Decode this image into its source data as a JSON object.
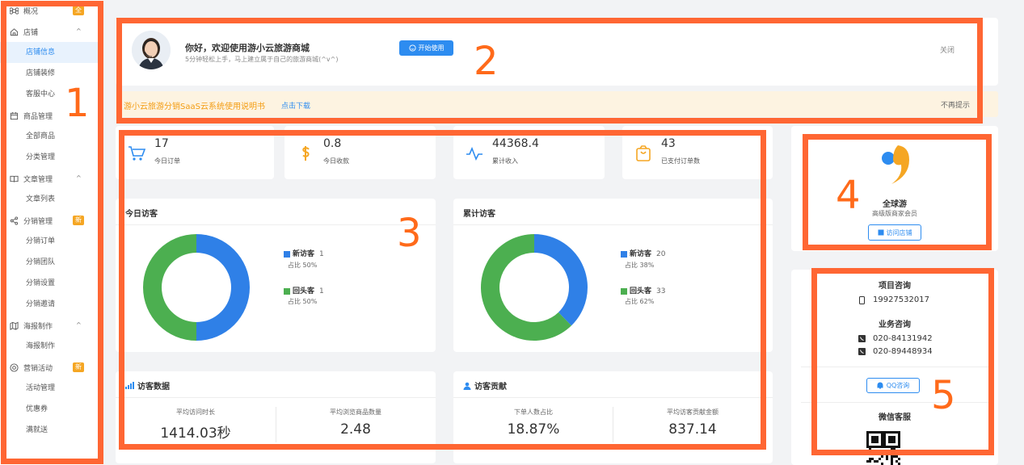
{
  "sidebar": {
    "groups": [
      {
        "label": "概况",
        "icon": "command-icon",
        "badge": "全"
      },
      {
        "label": "店铺",
        "icon": "home-icon",
        "chevron": "^",
        "items": [
          "店铺信息",
          "店铺装修",
          "客服中心"
        ]
      },
      {
        "label": "商品管理",
        "icon": "calendar-icon",
        "chevron": "^",
        "items": [
          "全部商品",
          "分类管理"
        ]
      },
      {
        "label": "文章管理",
        "icon": "book-icon",
        "chevron": "^",
        "items": [
          "文章列表"
        ]
      },
      {
        "label": "分销管理",
        "icon": "share-icon",
        "badge": "新",
        "items": [
          "分销订单",
          "分销团队",
          "分销设置",
          "分销邀请"
        ]
      },
      {
        "label": "海报制作",
        "icon": "map-icon",
        "chevron": "^",
        "items": [
          "海报制作"
        ]
      },
      {
        "label": "营销活动",
        "icon": "aperture-icon",
        "badge": "新",
        "items": [
          "活动管理",
          "优惠券",
          "满就送"
        ]
      }
    ],
    "active_item": "店铺信息"
  },
  "welcome": {
    "title": "你好，欢迎使用游小云旅游商城",
    "subtitle": "5分钟轻松上手，马上建立属于自己的旅游商城(^v^)",
    "start_button": "开始使用",
    "close": "关闭"
  },
  "notice": {
    "text": "游小云旅游分销SaaS云系统使用说明书",
    "link": "点击下载",
    "dismiss": "不再提示"
  },
  "stats": [
    {
      "value": "17",
      "label": "今日订单",
      "icon": "cart-icon"
    },
    {
      "value": "0.8",
      "label": "今日收款",
      "icon": "dollar-icon"
    },
    {
      "value": "44368.4",
      "label": "累计收入",
      "icon": "activity-icon"
    },
    {
      "value": "43",
      "label": "已支付订单数",
      "icon": "bag-icon"
    }
  ],
  "today_visitors": {
    "title": "今日访客",
    "new_label": "新访客",
    "new_count": "1",
    "new_pct": "占比  50%",
    "return_label": "回头客",
    "return_count": "1",
    "return_pct": "占比  50%"
  },
  "total_visitors": {
    "title": "累计访客",
    "new_label": "新访客",
    "new_count": "20",
    "new_pct": "占比  38%",
    "return_label": "回头客",
    "return_count": "33",
    "return_pct": "占比  62%"
  },
  "chart_data": [
    {
      "type": "pie",
      "title": "今日访客",
      "labels": [
        "新访客",
        "回头客"
      ],
      "values": [
        1,
        1
      ],
      "percent": [
        50,
        50
      ],
      "colors": [
        "#2f80e7",
        "#4caf50"
      ]
    },
    {
      "type": "pie",
      "title": "累计访客",
      "labels": [
        "新访客",
        "回头客"
      ],
      "values": [
        20,
        33
      ],
      "percent": [
        38,
        62
      ],
      "colors": [
        "#2f80e7",
        "#4caf50"
      ]
    }
  ],
  "visitor_data": {
    "title": "访客数据",
    "m1_label": "平均访问时长",
    "m1_value": "1414.03秒",
    "m2_label": "平均浏览商品数量",
    "m2_value": "2.48"
  },
  "visitor_contribution": {
    "title": "访客贡献",
    "m1_label": "下单人数占比",
    "m1_value": "18.87%",
    "m2_label": "平均访客贡献金额",
    "m2_value": "837.14"
  },
  "brand": {
    "name": "全球游",
    "level": "高级版商家会员",
    "visit_button": "访问店铺"
  },
  "contact": {
    "project_title": "项目咨询",
    "project_phone": "19927532017",
    "business_title": "业务咨询",
    "business_phones": [
      "020-84131942",
      "020-89448934"
    ],
    "qq_button": "QQ咨询",
    "wechat_title": "微信客服"
  },
  "annotations": [
    "1",
    "2",
    "3",
    "4",
    "5"
  ],
  "colors": {
    "accent": "#2d8cf0",
    "annotation": "#ff6633",
    "new_visitor": "#2f80e7",
    "returning": "#4caf50",
    "notice_bg": "#fdf3e1"
  }
}
